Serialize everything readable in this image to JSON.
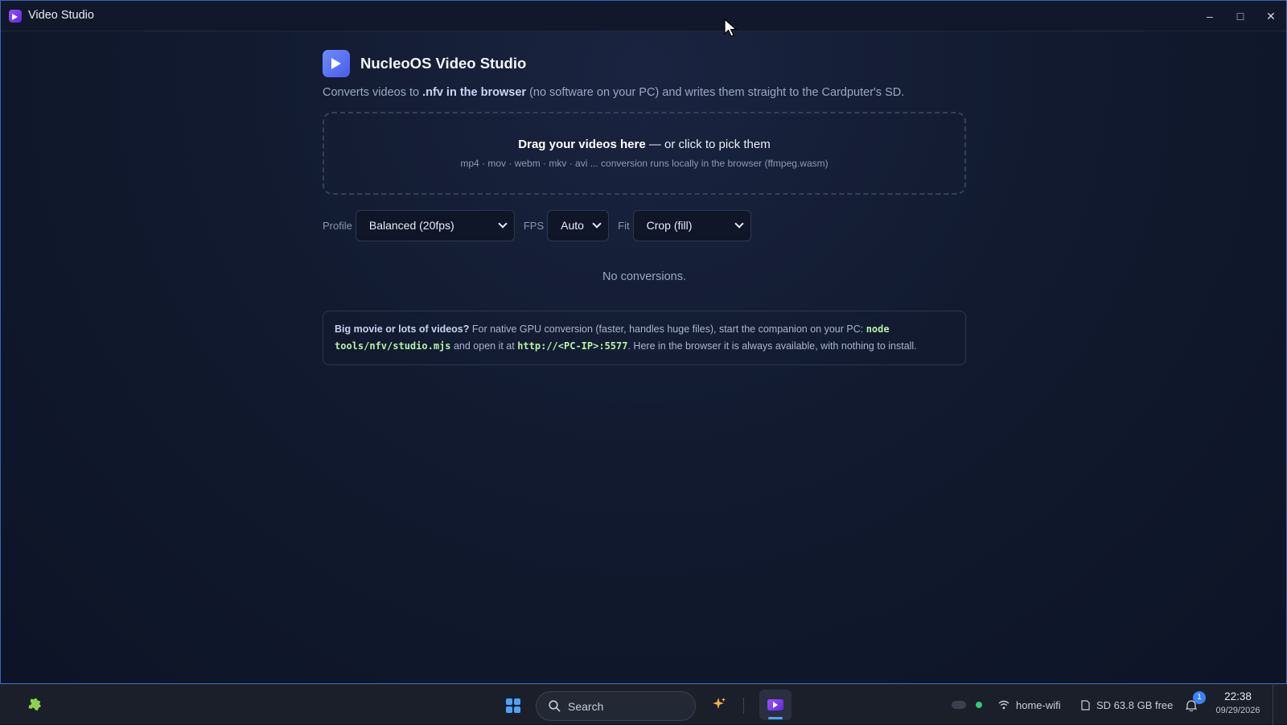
{
  "window": {
    "title": "Video Studio",
    "controls": {
      "minimize": "–",
      "maximize": "□",
      "close": "✕"
    }
  },
  "app": {
    "title": "NucleoOS Video Studio",
    "subtitle_pre": "Converts videos to ",
    "subtitle_bold": ".nfv in the browser",
    "subtitle_post": " (no software on your PC) and writes them straight to the Cardputer's SD."
  },
  "dropzone": {
    "main_bold": "Drag your videos here",
    "main_rest": " — or click to pick them",
    "formats": "mp4 · mov · webm · mkv · avi ... conversion runs locally in the browser (ffmpeg.wasm)"
  },
  "controls": {
    "profile_label": "Profile",
    "profile_value": "Balanced (20fps)",
    "fps_label": "FPS",
    "fps_value": "Auto",
    "fit_label": "Fit",
    "fit_value": "Crop (fill)"
  },
  "status": {
    "empty": "No conversions."
  },
  "info": {
    "lead": "Big movie or lots of videos?",
    "text1": " For native GPU conversion (faster, handles huge files), start the companion on your PC: ",
    "code1": "node tools/nfv/studio.mjs",
    "text2": " and open it at ",
    "code2": "http://<PC-IP>:5577",
    "text3": ". Here in the browser it is always available, with nothing to install."
  },
  "taskbar": {
    "search_label": "Search",
    "wifi": "home-wifi",
    "storage": "SD 63.8 GB free",
    "notifications": "1",
    "time": "22:38",
    "date": "09/29/2026"
  },
  "colors": {
    "accent": "#4aa3ff",
    "window_border": "#3a64b8",
    "code": "#b9f0a6",
    "status_dot": "#2ecc71"
  }
}
